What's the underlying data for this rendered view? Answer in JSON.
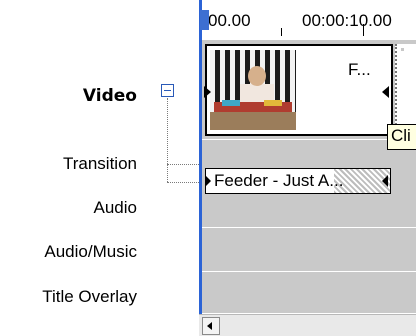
{
  "tracks": {
    "video_label": "Video",
    "transition_label": "Transition",
    "audio_label": "Audio",
    "audio_music_label": "Audio/Music",
    "title_overlay_label": "Title Overlay"
  },
  "ruler": {
    "start_time": "00.00",
    "mark_time": "00:00:10.00"
  },
  "video_clip": {
    "title": "F..."
  },
  "tooltip": {
    "text": "Cli"
  },
  "audio_clip": {
    "title": "Feeder - Just A..."
  },
  "colors": {
    "track_bg": "#c9c9c9",
    "playhead": "#2b63d6",
    "collapse_icon": "#2a5ab8",
    "tooltip_bg": "#ffffe1"
  },
  "icons": {
    "collapse": "collapse-minus-icon",
    "scroll_left": "scroll-left-arrow-icon"
  }
}
